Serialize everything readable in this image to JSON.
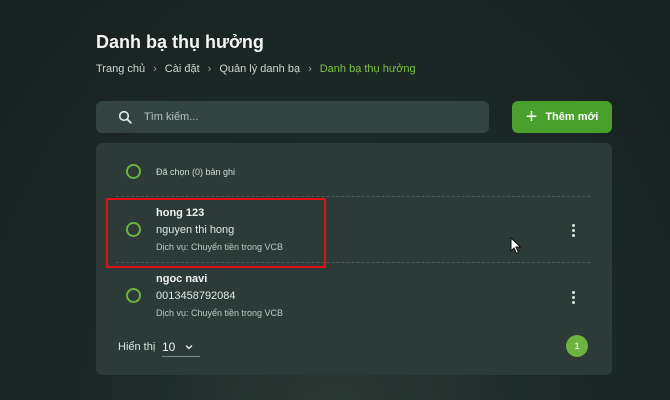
{
  "page": {
    "title": "Danh bạ thụ hưởng"
  },
  "breadcrumb": {
    "items": [
      "Trang chủ",
      "Cài đặt",
      "Quản lý danh bạ",
      "Danh bạ thụ hưởng"
    ],
    "separator": "›"
  },
  "search": {
    "placeholder": "Tìm kiếm...",
    "icon": "search-icon"
  },
  "toolbar": {
    "add_icon": "+",
    "add_label": "Thêm mới"
  },
  "list": {
    "selected_summary": "Đã chọn (0) bản ghi",
    "items": [
      {
        "name": "hong 123",
        "account": "nguyen thi hong",
        "service": "Dịch vụ: Chuyển tiền trong VCB"
      },
      {
        "name": "ngoc navi",
        "account": "0013458792084",
        "service": "Dịch vụ: Chuyển tiền trong VCB"
      }
    ]
  },
  "pagination": {
    "page_size_label": "Hiển thị",
    "page_size": "10",
    "current_page": "1"
  },
  "colors": {
    "accent": "#4aa02c",
    "radio": "#6cb33f",
    "breadcrumb_current": "#7bc142",
    "highlight_box": "#e0101a"
  }
}
